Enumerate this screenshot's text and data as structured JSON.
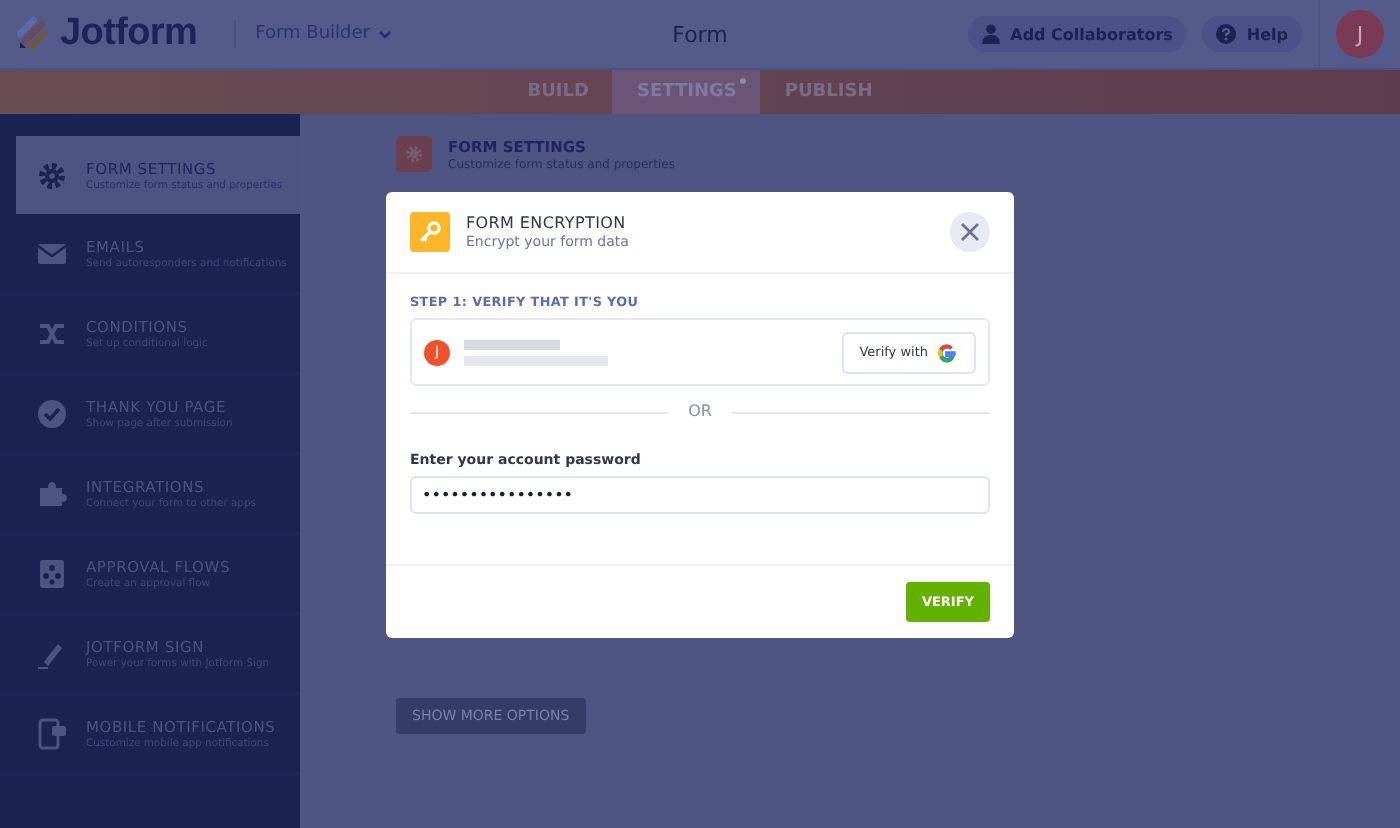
{
  "header": {
    "logo": "Jotform",
    "builder_menu": "Form Builder",
    "title": "Form",
    "collaborators_button": "Add Collaborators",
    "help_button": "Help",
    "avatar_initial": "J"
  },
  "tabs": [
    {
      "label": "BUILD",
      "selected": false,
      "badge": false
    },
    {
      "label": "SETTINGS",
      "selected": true,
      "badge": true
    },
    {
      "label": "PUBLISH",
      "selected": false,
      "badge": false
    }
  ],
  "sidebar": {
    "items": [
      {
        "kind": "gear",
        "title": "FORM SETTINGS",
        "subtitle": "Customize form status and properties",
        "selected": true
      },
      {
        "kind": "mail",
        "title": "EMAILS",
        "subtitle": "Send autoresponders and notifications",
        "selected": false
      },
      {
        "kind": "shuffle",
        "title": "CONDITIONS",
        "subtitle": "Set up conditional logic",
        "selected": false
      },
      {
        "kind": "check",
        "title": "THANK YOU PAGE",
        "subtitle": "Show page after submission",
        "selected": false
      },
      {
        "kind": "puzzle",
        "title": "INTEGRATIONS",
        "subtitle": "Connect your form to other apps",
        "selected": false
      },
      {
        "kind": "flow",
        "title": "APPROVAL FLOWS",
        "subtitle": "Create an approval flow",
        "selected": false
      },
      {
        "kind": "pen",
        "title": "JOTFORM SIGN",
        "subtitle": "Power your forms with Jotform Sign",
        "selected": false
      },
      {
        "kind": "phone",
        "title": "MOBILE NOTIFICATIONS",
        "subtitle": "Customize mobile app notifications",
        "selected": false
      }
    ]
  },
  "main": {
    "section_title": "FORM SETTINGS",
    "section_subtitle": "Customize form status and properties",
    "more_button": "SHOW MORE OPTIONS"
  },
  "dialog": {
    "title": "FORM ENCRYPTION",
    "subtitle": "Encrypt your form data",
    "step_label": "STEP 1: VERIFY THAT IT'S YOU",
    "account_initial": "J",
    "verify_with_button": "Verify with",
    "divider_text": "OR",
    "password_label": "Enter your account password",
    "password_value": "••••••••••••••••",
    "verify_button": "VERIFY"
  }
}
